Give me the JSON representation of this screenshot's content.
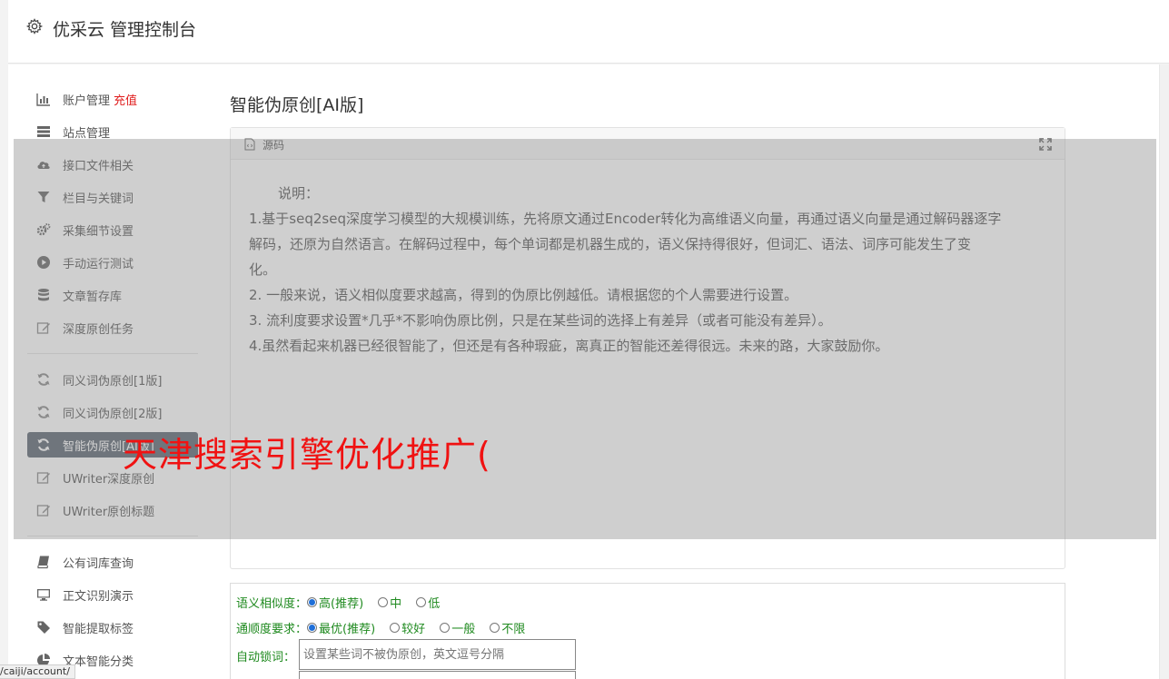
{
  "header": {
    "title": "优采云 管理控制台",
    "icon": "gear-icon"
  },
  "sidebar": {
    "items": [
      {
        "label": "账户管理",
        "badge": "充值",
        "icon": "bar-chart-icon"
      },
      {
        "label": "站点管理",
        "icon": "server-icon"
      },
      {
        "label": "接口文件相关",
        "icon": "cloud-upload-icon"
      },
      {
        "label": "栏目与关键词",
        "icon": "filter-icon"
      },
      {
        "label": "采集细节设置",
        "icon": "gears-icon"
      },
      {
        "label": "手动运行测试",
        "icon": "play-circle-icon"
      },
      {
        "label": "文章暂存库",
        "icon": "database-icon"
      },
      {
        "label": "深度原创任务",
        "icon": "edit-icon"
      },
      {
        "label": "同义词伪原创[1版]",
        "icon": "refresh-icon"
      },
      {
        "label": "同义词伪原创[2版]",
        "icon": "refresh-icon"
      },
      {
        "label": "智能伪原创[AI版]",
        "icon": "refresh-icon",
        "active": true
      },
      {
        "label": "UWriter深度原创",
        "icon": "edit-icon"
      },
      {
        "label": "UWriter原创标题",
        "icon": "edit-icon"
      },
      {
        "label": "公有词库查询",
        "icon": "book-icon"
      },
      {
        "label": "正文识别演示",
        "icon": "monitor-icon"
      },
      {
        "label": "智能提取标签",
        "icon": "tag-icon"
      },
      {
        "label": "文本智能分类",
        "icon": "pie-chart-icon"
      }
    ]
  },
  "main": {
    "title": "智能伪原创[AI版]",
    "panel": {
      "label": "源码",
      "lines": [
        "说明：",
        "1.基于seq2seq深度学习模型的大规模训练，先将原文通过Encoder转化为高维语义向量，再通过语义向量是通过解码器逐字",
        "解码，还原为自然语言。在解码过程中，每个单词都是机器生成的，语义保持得很好，但词汇、语法、词序可能发生了变",
        "化。",
        "2. 一般来说，语义相似度要求越高，得到的伪原比例越低。请根据您的个人需要进行设置。",
        "3. 流利度要求设置*几乎*不影响伪原比例，只是在某些词的选择上有差异（或者可能没有差异）。",
        "4.虽然看起来机器已经很智能了，但还是有各种瑕疵，离真正的智能还差得很远。未来的路，大家鼓励你。"
      ]
    },
    "form": {
      "similarity": {
        "label": "语义相似度：",
        "options": [
          "高(推荐)",
          "中",
          "低"
        ],
        "selected": 0
      },
      "fluency": {
        "label": "通顺度要求：",
        "options": [
          "最优(推荐)",
          "较好",
          "一般",
          "不限"
        ],
        "selected": 0
      },
      "lock": {
        "label": "自动锁词：",
        "placeholder": "设置某些词不被伪原创，英文逗号分隔"
      }
    }
  },
  "watermark": "天津搜索引擎优化推广(",
  "status_url": "/caiji/account/",
  "colors": {
    "active_nav": "#5b6470",
    "badge": "#e01e1e",
    "form_label": "#1f8a1f",
    "watermark": "#f01212"
  }
}
